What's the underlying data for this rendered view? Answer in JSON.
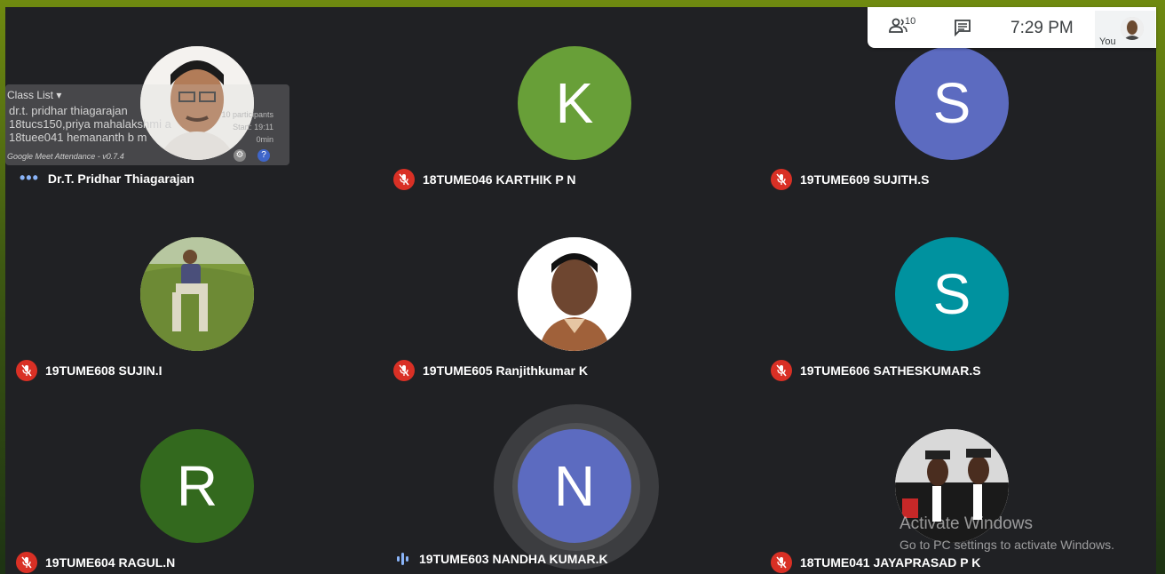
{
  "topbar": {
    "participant_count": "10",
    "time": "7:29  PM",
    "self_label": "You"
  },
  "participants": [
    {
      "name": "Dr.T. Pridhar Thiagarajan",
      "avatar": "photo",
      "status": "speaking-dots"
    },
    {
      "name": "18TUME046 KARTHIK P N",
      "avatar_letter": "K",
      "color": "#689f38",
      "status": "muted"
    },
    {
      "name": "19TUME609 SUJITH.S",
      "avatar_letter": "S",
      "color": "#5c6bc0",
      "status": "muted"
    },
    {
      "name": "19TUME608 SUJIN.I",
      "avatar": "photo",
      "status": "muted"
    },
    {
      "name": "19TUME605 Ranjithkumar K",
      "avatar": "photo",
      "status": "muted"
    },
    {
      "name": "19TUME606 SATHESKUMAR.S",
      "avatar_letter": "S",
      "color": "#00929f",
      "status": "muted"
    },
    {
      "name": "19TUME604 RAGUL.N",
      "avatar_letter": "R",
      "color": "#33691e",
      "status": "muted"
    },
    {
      "name": "19TUME603 NANDHA KUMAR.K",
      "avatar_letter": "N",
      "color": "#5c6bc0",
      "status": "speaking"
    },
    {
      "name": "18TUME041 JAYAPRASAD P K",
      "avatar": "photo",
      "status": "muted"
    }
  ],
  "attendance_overlay": {
    "header": "Class List",
    "lines": [
      "dr.t. pridhar thiagarajan",
      "18tucs150,priya mahalakshmi a",
      "18tuee041 hemananth b m"
    ],
    "participants_label": "10 participants",
    "start_label": "Start: 19:11",
    "duration": "0min",
    "footer": "Google Meet Attendance - v0.7.4"
  },
  "watermark": {
    "title": "Activate Windows",
    "subtitle": "Go to PC settings to activate Windows."
  }
}
